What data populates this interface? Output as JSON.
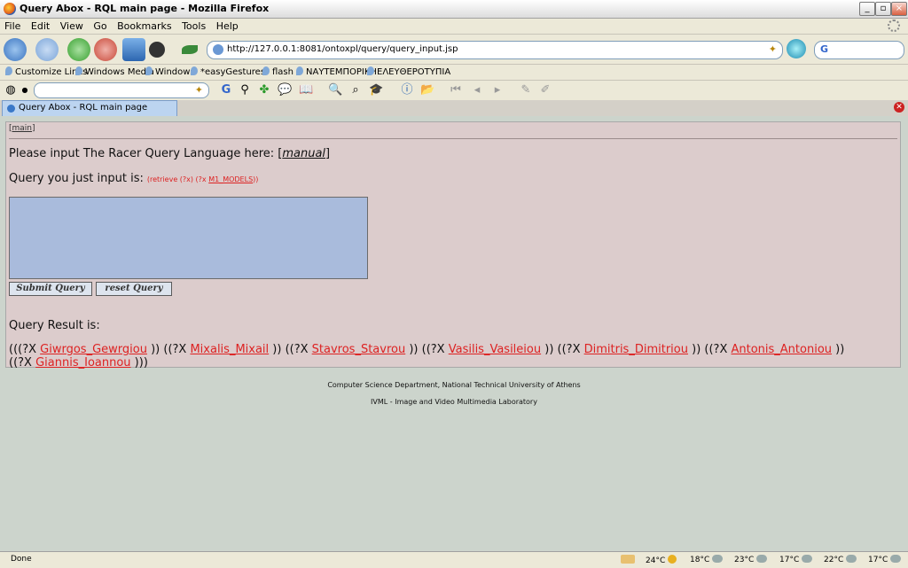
{
  "window": {
    "title": "Query Abox - RQL main page - Mozilla Firefox"
  },
  "menu": [
    "File",
    "Edit",
    "View",
    "Go",
    "Bookmarks",
    "Tools",
    "Help"
  ],
  "address": {
    "url": "http://127.0.0.1:8081/ontoxpl/query/query_input.jsp"
  },
  "search": {
    "engine_icon": "G"
  },
  "bookmarks": [
    "Customize Links",
    "Windows Media",
    "Windows",
    "*easyGestures*",
    "flash",
    "ΝΑΥΤΕΜΠΟΡΙΚΗ",
    "ΕΛΕΥΘΕΡΟΤΥΠΙΑ"
  ],
  "tab": {
    "label": "Query Abox - RQL main page"
  },
  "page": {
    "crumb_link": "main",
    "prompt_text": "Please input The Racer Query Language here: [",
    "prompt_link": "manual",
    "prompt_end": "]",
    "query_label": "Query you just input is:",
    "query_pre": "(retrieve (?x) (?x ",
    "query_link": "M1_MODELS",
    "query_post": "))",
    "submit_label": "Submit Query",
    "reset_label": "reset Query",
    "result_heading": "Query Result is:",
    "results": [
      {
        "pre": "(((?X ",
        "name": "Giwrgos_Gewrgiou",
        "post": " ))"
      },
      {
        "pre": " ((?X ",
        "name": "Mixalis_Mixail",
        "post": " ))"
      },
      {
        "pre": " ((?X ",
        "name": "Stavros_Stavrou",
        "post": " ))"
      },
      {
        "pre": " ((?X ",
        "name": "Vasilis_Vasileiou",
        "post": " ))"
      },
      {
        "pre": " ((?X ",
        "name": "Dimitris_Dimitriou",
        "post": " ))"
      },
      {
        "pre": " ((?X ",
        "name": "Antonis_Antoniou",
        "post": " ))"
      },
      {
        "pre": " ((?X ",
        "name": "Giannis_Ioannou",
        "post": " )))"
      }
    ],
    "footer_line1": "Computer Science Department, National Technical University of Athens",
    "footer_line2": "IVML - Image and Video Multimedia Laboratory"
  },
  "status": {
    "text": "Done",
    "temps": [
      "24°C",
      "18°C",
      "23°C",
      "17°C",
      "22°C",
      "17°C"
    ]
  }
}
